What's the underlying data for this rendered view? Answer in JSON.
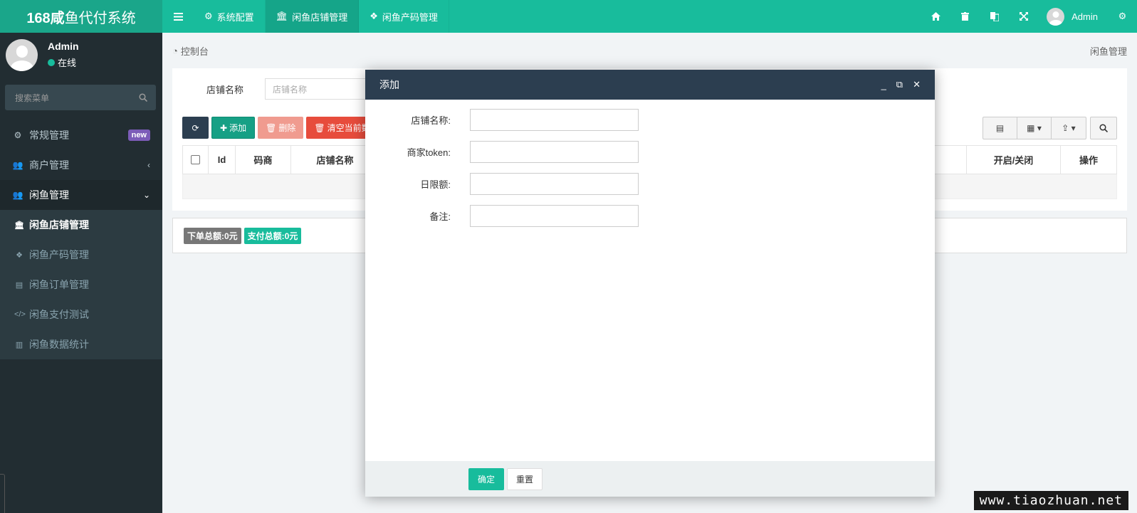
{
  "logo": {
    "bold": "168咸",
    "rest": "鱼代付系统"
  },
  "topnav": {
    "tabs": [
      {
        "icon": "gear",
        "label": "系统配置"
      },
      {
        "icon": "bank",
        "label": "闲鱼店铺管理"
      },
      {
        "icon": "cubes",
        "label": "闲鱼产码管理"
      }
    ],
    "user": "Admin"
  },
  "sidebar": {
    "user_name": "Admin",
    "status": "在线",
    "search_placeholder": "搜索菜单",
    "items": [
      {
        "label": "常规管理",
        "badge": "new"
      },
      {
        "label": "商户管理"
      },
      {
        "label": "闲鱼管理"
      }
    ],
    "submenu": [
      {
        "label": "闲鱼店铺管理"
      },
      {
        "label": "闲鱼产码管理"
      },
      {
        "label": "闲鱼订单管理"
      },
      {
        "label": "闲鱼支付测试"
      },
      {
        "label": "闲鱼数据统计"
      }
    ]
  },
  "breadcrumb": {
    "left": "控制台",
    "right": "闲鱼管理"
  },
  "filter": {
    "label": "店铺名称",
    "placeholder": "店铺名称"
  },
  "toolbar": {
    "add": "添加",
    "delete": "删除",
    "clear": "清空当前数"
  },
  "table": {
    "headers": [
      "Id",
      "码商",
      "店铺名称",
      "开启/关闭",
      "操作"
    ]
  },
  "summary": {
    "order_total": "下单总额:0元",
    "pay_total": "支付总额:0元"
  },
  "modal": {
    "title": "添加",
    "fields": [
      {
        "label": "店铺名称:",
        "value": ""
      },
      {
        "label": "商家token:",
        "value": ""
      },
      {
        "label": "日限额:",
        "value": ""
      },
      {
        "label": "备注:",
        "value": ""
      }
    ],
    "ok": "确定",
    "reset": "重置"
  },
  "watermark": "www.tiaozhuan.net",
  "colors": {
    "primary": "#18bc9c",
    "sidebar": "#222d32",
    "modal_header": "#2c3e50",
    "danger": "#e74c3c"
  }
}
